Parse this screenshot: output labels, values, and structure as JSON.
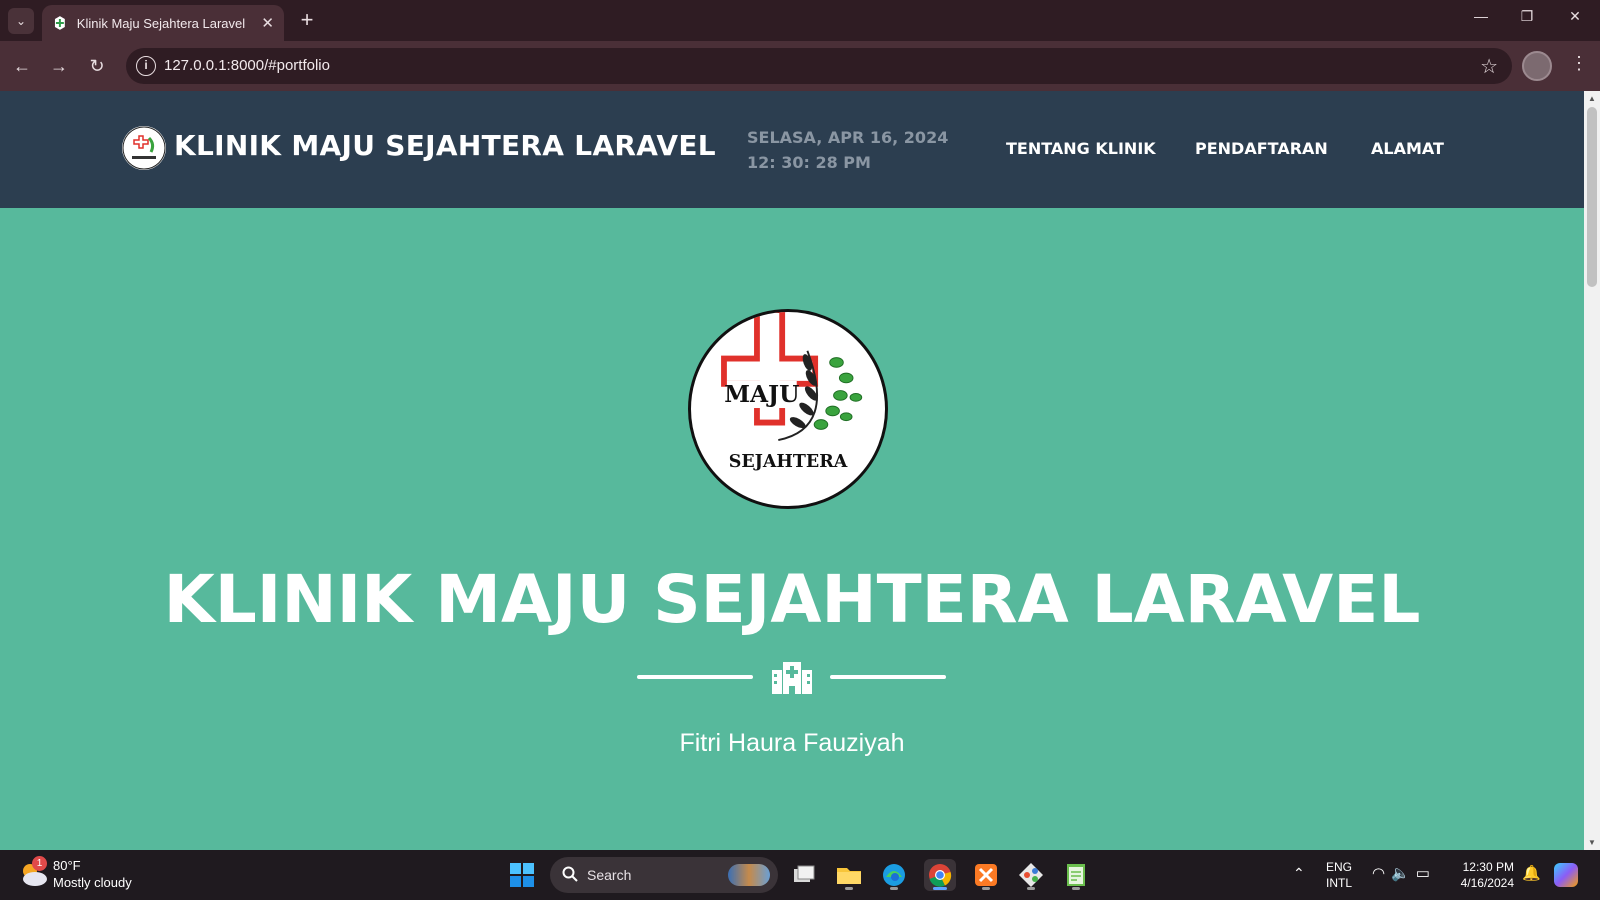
{
  "browser": {
    "tab_title": "Klinik Maju Sejahtera Laravel La",
    "tab_close": "✕",
    "new_tab": "+",
    "url": "127.0.0.1:8000/#portfolio",
    "window_controls": [
      "—",
      "❐",
      "✕"
    ]
  },
  "navbar": {
    "brand": "KLINIK MAJU SEJAHTERA LARAVEL",
    "date": "SELASA, APR 16, 2024",
    "time": "12: 30: 28 PM",
    "links": [
      "TENTANG KLINIK",
      "PENDAFTARAN",
      "ALAMAT"
    ]
  },
  "hero": {
    "logo_text_top": "MAJU",
    "logo_text_bottom": "SEJAHTERA",
    "title": "KLINIK MAJU SEJAHTERA LARAVEL",
    "subtitle": "Fitri Haura Fauziyah",
    "divider_icon": "hospital-icon"
  },
  "taskbar": {
    "weather_badge": "1",
    "temperature": "80°F",
    "weather": "Mostly cloudy",
    "search": "Search",
    "apps": [
      "task-view",
      "file-explorer",
      "edge",
      "chrome",
      "xampp",
      "git",
      "notepad"
    ],
    "lang_top": "ENG",
    "lang_bottom": "INTL",
    "time": "12:30 PM",
    "date": "4/16/2024"
  },
  "colors": {
    "page_bg": "#57b99c",
    "navbar_bg": "#2c3e50",
    "accent_red": "#e0312b",
    "leaf_green": "#3aa33e"
  }
}
